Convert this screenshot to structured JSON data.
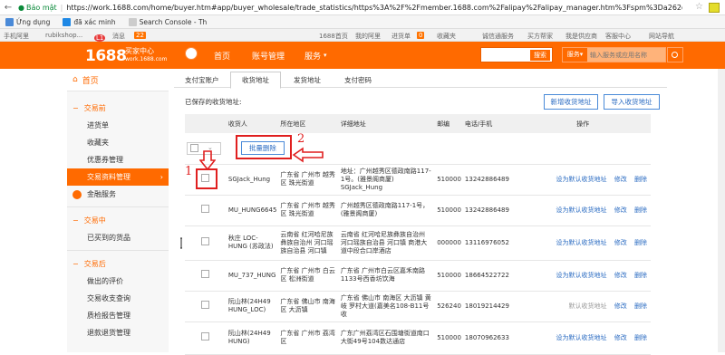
{
  "browser": {
    "security_label": "Bảo mật",
    "url": "https://work.1688.com/home/buyer.htm#app/buyer_wholesale/trade_statistics/https%3A%2F%2Fmember.1688.com%2Falipay%2Falipay_manager.htm%3Fspm%3Da262do.8164347.db"
  },
  "bookmarks": [
    {
      "label": "Ứng dụng",
      "color": "#4a8ad8"
    },
    {
      "label": "đã xác minh",
      "color": "#1e88e5"
    },
    {
      "label": "Search Console - Th",
      "color": "#888888"
    }
  ],
  "topbar": {
    "left1": "手机阿里",
    "user": "rubikshop...",
    "msg": "消息",
    "msg_count": "22",
    "links": [
      "1688首页",
      "我的阿里",
      "进货单",
      "收藏夹",
      "诚信通服务",
      "买方帮家",
      "我是供应商",
      "客服中心",
      "网站导航"
    ],
    "cart_count": "0"
  },
  "header": {
    "logo": "1688",
    "logo_sub1": "买家中心",
    "logo_sub2": "work.1688.com",
    "nav": [
      "首页",
      "账号管理",
      "服务"
    ],
    "search_btn": "搜索",
    "search_type": "服务",
    "search_placeholder": "输入服务或应用名称"
  },
  "sidebar": {
    "home": "首页",
    "groups": [
      {
        "title": "交易前",
        "items": [
          "进货单",
          "收藏夹",
          "优惠券管理",
          "交易资料管理",
          "金融服务"
        ]
      },
      {
        "title": "交易中",
        "items": [
          "已买到的货品"
        ]
      },
      {
        "title": "交易后",
        "items": [
          "做出的评价",
          "交易收支查询",
          "质检报告管理",
          "退款退货管理"
        ]
      }
    ],
    "active": "交易资料管理"
  },
  "tabs": [
    "支付宝账户",
    "收货地址",
    "发货地址",
    "支付密码"
  ],
  "active_tab": "收货地址",
  "saved_label": "已保存的收货地址:",
  "buttons": {
    "add": "新增收货地址",
    "import": "导入收货地址",
    "batch_delete": "批量删除"
  },
  "columns": [
    "收货人",
    "所在地区",
    "详细地址",
    "邮编",
    "电话/手机",
    "操作"
  ],
  "rows": [
    {
      "name": "SGJack_Hung",
      "region": "广东省 广州市 越秀区 珠光街道",
      "address": "地址：广州越秀区德政南路117-1号。(雅景阁商厦) SGJack_Hung",
      "zip": "510000",
      "phone": "13242886489",
      "action1": "设为默认收货地址",
      "action2": "修改",
      "action3": "删除"
    },
    {
      "name": "MU_HUNG6645",
      "region": "广东省 广州市 越秀区 珠光街道",
      "address": "广州越秀区德政南路117-1号，(雅景阁商厦)",
      "zip": "510000",
      "phone": "13242886489",
      "action1": "设为默认收货地址",
      "action2": "修改",
      "action3": "删除"
    },
    {
      "name": "秋庄 LOC-HUNG (苏政法)",
      "region": "云南省 红河哈尼族彝族自治州 河口瑶族自治县 河口镇",
      "address": "云南省 红河哈尼族彝族自治州 河口瑶族自治县 河口镇 商港大道中段合口岸酒店",
      "zip": "000000",
      "phone": "13116976052",
      "action1": "设为默认收货地址",
      "action2": "修改",
      "action3": "删除"
    },
    {
      "name": "MU_737_HUNG",
      "region": "广东省 广州市 白云区 松洲街道",
      "address": "广东省 广州市白云区嘉禾南路1133号西香坊饮海",
      "zip": "510000",
      "phone": "18664522722",
      "action1": "设为默认收货地址",
      "action2": "修改",
      "action3": "删除"
    },
    {
      "name": "阮山林(24H49 HUNG_LOC)",
      "region": "广东省 佛山市 南海区 大沥镇",
      "address": "广东省 佛山市 南海区 大沥镇 黄岐 罗村大道(嘉美名108-B11号 收",
      "zip": "526240",
      "phone": "18019214429",
      "action1": "默认收货地址",
      "action2": "修改",
      "action3": "删除"
    },
    {
      "name": "阮山林(24H49 HUNG)",
      "region": "广东省 广州市 荔湾区",
      "address": "广东广州荔湾区石围塘街道南口大街49号104数达通店",
      "zip": "510000",
      "phone": "18070962633",
      "action1": "设为默认收货地址",
      "action2": "修改",
      "action3": "删除"
    }
  ],
  "annotations": {
    "n1": "1",
    "n2": "2"
  },
  "colors": {
    "brand": "#ff6a00",
    "link": "#2a6bc2",
    "annotation": "#e01f1f"
  }
}
